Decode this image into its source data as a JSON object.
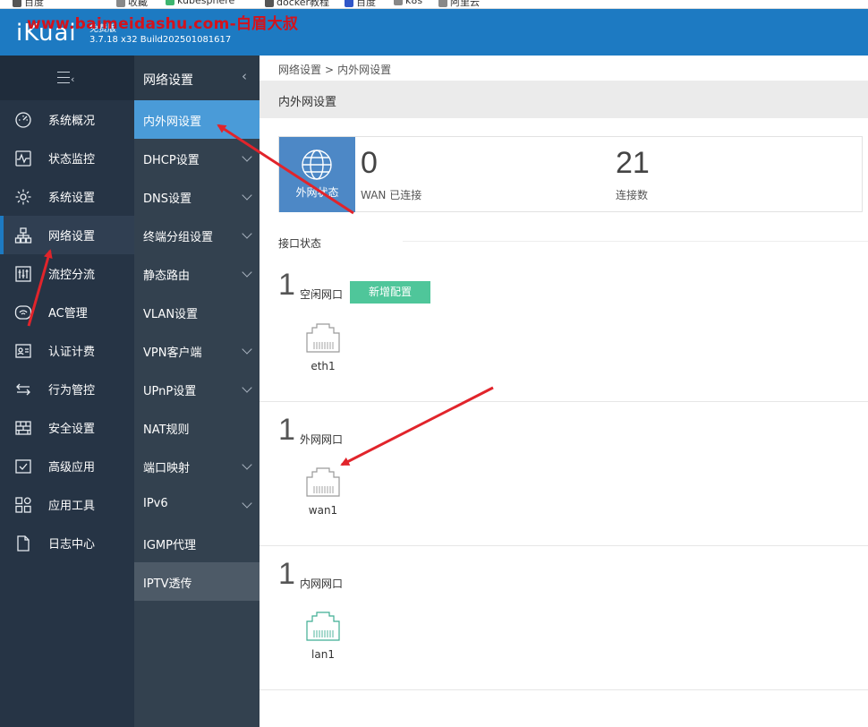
{
  "bookmarks": [
    "百度",
    "收藏",
    "kubesphere",
    "docker教程",
    "百度",
    "k8s",
    "阿里云"
  ],
  "watermark": "www.baimeidashu.com-白眉大叔",
  "header": {
    "logo": "iKuai",
    "edition": "免费版",
    "build": "3.7.18 x32 Build202501081617",
    "bg_color": "#1d7ac2"
  },
  "sidebar": {
    "toggle_icon": "menu-collapse-icon",
    "items": [
      {
        "label": "系统概况",
        "icon": "dashboard-icon"
      },
      {
        "label": "状态监控",
        "icon": "pulse-icon"
      },
      {
        "label": "系统设置",
        "icon": "gear-icon"
      },
      {
        "label": "网络设置",
        "icon": "network-icon",
        "active": true
      },
      {
        "label": "流控分流",
        "icon": "sliders-icon"
      },
      {
        "label": "AC管理",
        "icon": "wifi-icon"
      },
      {
        "label": "认证计费",
        "icon": "id-card-icon"
      },
      {
        "label": "行为管控",
        "icon": "exchange-icon"
      },
      {
        "label": "安全设置",
        "icon": "firewall-icon"
      },
      {
        "label": "高级应用",
        "icon": "checklist-icon"
      },
      {
        "label": "应用工具",
        "icon": "tools-icon"
      },
      {
        "label": "日志中心",
        "icon": "document-icon"
      }
    ]
  },
  "subbar": {
    "title": "网络设置",
    "items": [
      {
        "label": "内外网设置",
        "active": true,
        "arrow": false
      },
      {
        "label": "DHCP设置",
        "arrow": true
      },
      {
        "label": "DNS设置",
        "arrow": true
      },
      {
        "label": "终端分组设置",
        "arrow": true
      },
      {
        "label": "静态路由",
        "arrow": true
      },
      {
        "label": "VLAN设置",
        "arrow": false
      },
      {
        "label": "VPN客户端",
        "arrow": true
      },
      {
        "label": "UPnP设置",
        "arrow": true
      },
      {
        "label": "NAT规则",
        "arrow": false
      },
      {
        "label": "端口映射",
        "arrow": true
      },
      {
        "label": "IPv6",
        "arrow": true
      },
      {
        "label": "IGMP代理",
        "arrow": false
      },
      {
        "label": "IPTV透传",
        "highlight": true,
        "arrow": false
      }
    ]
  },
  "main": {
    "breadcrumb": [
      "网络设置",
      "内外网设置"
    ],
    "breadcrumb_sep": ">",
    "title": "内外网设置",
    "wan_status": {
      "icon_caption": "外网状态",
      "wan_count": "0",
      "wan_label": "WAN 已连接",
      "conn_count": "21",
      "conn_label": "连接数"
    },
    "interface_section": "接口状态",
    "groups": [
      {
        "count": "1",
        "name": "空闲网口",
        "button": "新增配置",
        "ports": [
          "eth1"
        ],
        "port_color": "#999999"
      },
      {
        "count": "1",
        "name": "外网网口",
        "ports": [
          "wan1"
        ],
        "port_color": "#999999"
      },
      {
        "count": "1",
        "name": "内网网口",
        "ports": [
          "lan1"
        ],
        "port_color": "#3fae93"
      }
    ]
  },
  "annotation_color": "#e1242b"
}
